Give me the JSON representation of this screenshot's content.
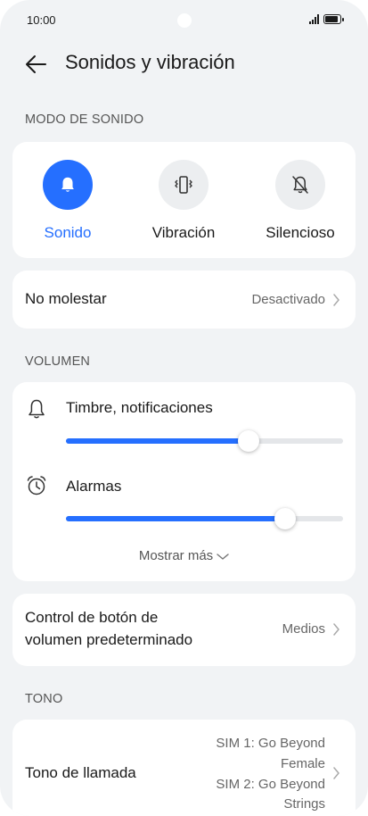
{
  "status_bar": {
    "time": "10:00",
    "battery_level": 0.9
  },
  "header": {
    "title": "Sonidos y vibración"
  },
  "sound_mode": {
    "section_title": "MODO DE SONIDO",
    "modes": [
      {
        "label": "Sonido",
        "icon": "bell-icon",
        "active": true
      },
      {
        "label": "Vibración",
        "icon": "vibrate-icon",
        "active": false
      },
      {
        "label": "Silencioso",
        "icon": "bell-off-icon",
        "active": false
      }
    ]
  },
  "do_not_disturb": {
    "label": "No molestar",
    "value": "Desactivado"
  },
  "volume": {
    "section_title": "VOLUMEN",
    "sliders": [
      {
        "label": "Timbre, notificaciones",
        "icon": "bell-outline-icon",
        "level": 0.66
      },
      {
        "label": "Alarmas",
        "icon": "alarm-clock-icon",
        "level": 0.79
      }
    ],
    "show_more": "Mostrar más"
  },
  "volume_button": {
    "label_line1": "Control de botón de",
    "label_line2": "volumen predeterminado",
    "value": "Medios"
  },
  "tone": {
    "section_title": "TONO",
    "ringtone": {
      "label": "Tono de llamada",
      "sim1_line1": "SIM 1: Go Beyond",
      "sim1_line2": "Female",
      "sim2_line1": "SIM 2: Go Beyond",
      "sim2_line2": "Strings"
    }
  },
  "colors": {
    "accent": "#256fff",
    "background": "#f1f3f5",
    "card": "#ffffff"
  }
}
